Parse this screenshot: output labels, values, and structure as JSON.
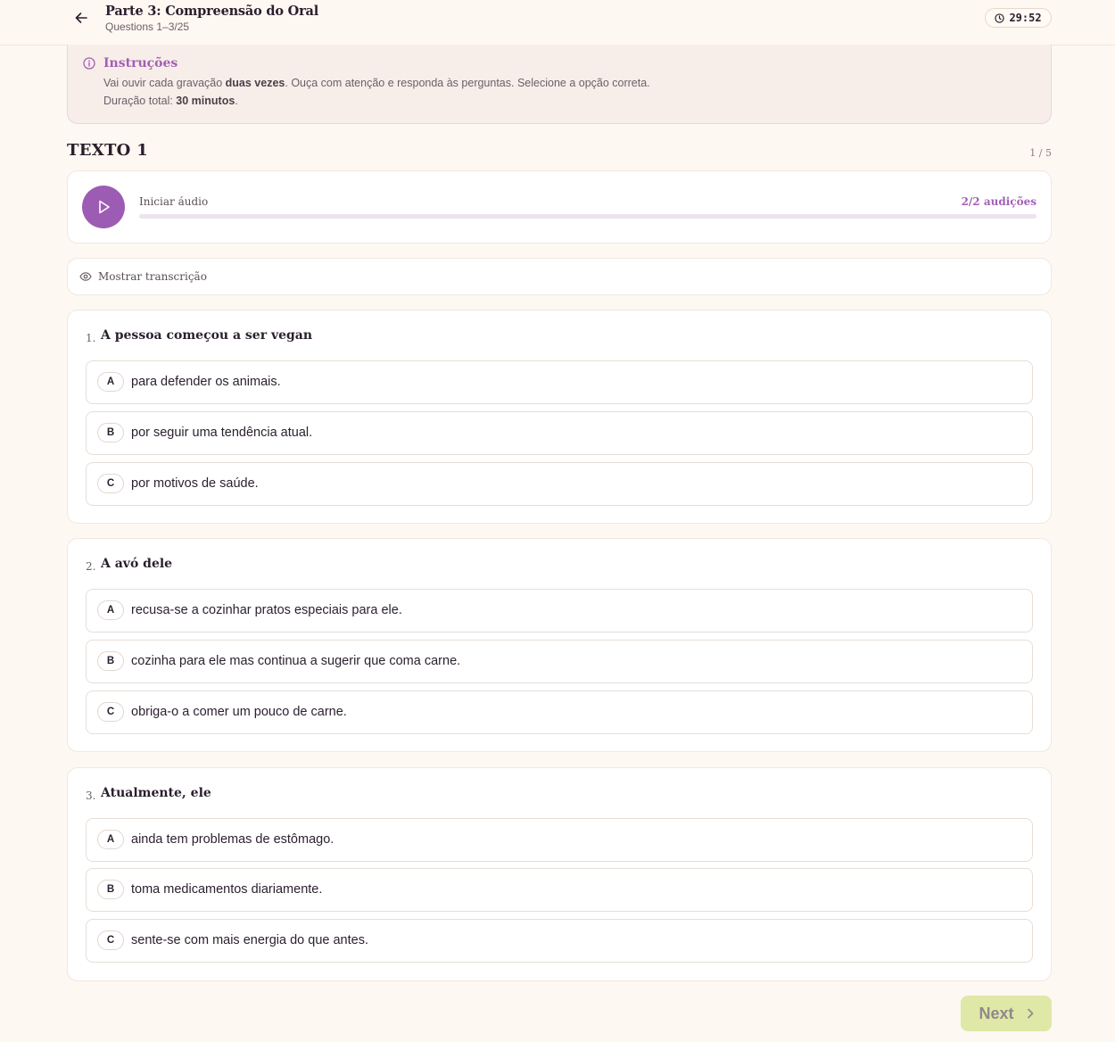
{
  "header": {
    "title": "Parte 3: Compreensão do Oral",
    "subtitle": "Questions 1–3/25",
    "timer": "29:52"
  },
  "instructions": {
    "title": "Instruções",
    "line1_pre": "Vai ouvir cada gravação ",
    "line1_bold": "duas vezes",
    "line1_post": ". Ouça com atenção e responda às perguntas. Selecione a opção correta.",
    "line2_pre": "Duração total: ",
    "line2_bold": "30 minutos",
    "line2_post": "."
  },
  "section": {
    "title": "TEXTO 1",
    "counter": "1 / 5"
  },
  "audio": {
    "label": "Iniciar áudio",
    "plays": "2/2 audições",
    "progress": 0
  },
  "transcript": {
    "label": "Mostrar transcrição"
  },
  "questions": [
    {
      "number": "1.",
      "text": "A pessoa começou a ser vegan",
      "options": [
        {
          "letter": "A",
          "text": "para defender os animais."
        },
        {
          "letter": "B",
          "text": "por seguir uma tendência atual."
        },
        {
          "letter": "C",
          "text": "por motivos de saúde."
        }
      ]
    },
    {
      "number": "2.",
      "text": "A avó dele",
      "options": [
        {
          "letter": "A",
          "text": "recusa-se a cozinhar pratos especiais para ele."
        },
        {
          "letter": "B",
          "text": "cozinha para ele mas continua a sugerir que coma carne."
        },
        {
          "letter": "C",
          "text": "obriga-o a comer um pouco de carne."
        }
      ]
    },
    {
      "number": "3.",
      "text": "Atualmente, ele",
      "options": [
        {
          "letter": "A",
          "text": "ainda tem problemas de estômago."
        },
        {
          "letter": "B",
          "text": "toma medicamentos diariamente."
        },
        {
          "letter": "C",
          "text": "sente-se com mais energia do que antes."
        }
      ]
    }
  ],
  "footer": {
    "next_label": "Next"
  },
  "colors": {
    "accent": "#9d5cb3",
    "background": "#fdf8f2",
    "next_button": "#dfe8a7"
  }
}
